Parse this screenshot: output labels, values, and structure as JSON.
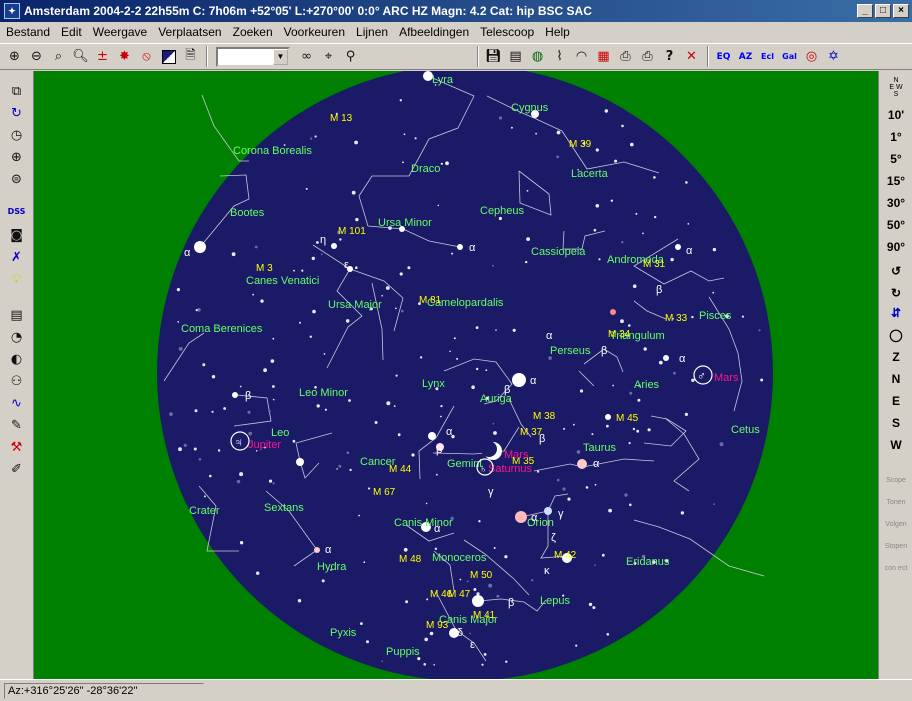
{
  "window": {
    "title": "Amsterdam 2004-2-2  22h55m C:  7h06m +52°05' L:+270°00' 0:0° ARC HZ  Magn: 4.2 Cat: hip BSC SAC"
  },
  "menu": [
    "Bestand",
    "Edit",
    "Weergave",
    "Verplaatsen",
    "Zoeken",
    "Voorkeuren",
    "Lijnen",
    "Afbeeldingen",
    "Telescoop",
    "Help"
  ],
  "right_toolbar": {
    "compass_labels": [
      "N",
      "E",
      "W",
      "S"
    ],
    "fov": [
      "10'",
      "1°",
      "5°",
      "15°",
      "30°",
      "50°",
      "90°"
    ],
    "directions": [
      "Z",
      "N",
      "E",
      "S",
      "W"
    ],
    "faded": [
      "Scope",
      "Tonen",
      "Volgen",
      "Stopen",
      "con ect"
    ]
  },
  "status": {
    "coords": "Az:+316°25'26\" -28°36'22\""
  },
  "colors": {
    "sky": "#1a1a66",
    "background": "#008000",
    "constellation": "#66ff66",
    "deep_sky": "#ffff00",
    "planet": "#ff1493",
    "line": "#c8c8dc"
  },
  "map": {
    "constellations": [
      {
        "name": "Lyra"
      },
      {
        "name": "Cygnus"
      },
      {
        "name": "Corona Borealis"
      },
      {
        "name": "Draco"
      },
      {
        "name": "Lacerta"
      },
      {
        "name": "Bootes"
      },
      {
        "name": "Ursa Minor"
      },
      {
        "name": "Cepheus"
      },
      {
        "name": "Cassiopeia"
      },
      {
        "name": "Andromeda"
      },
      {
        "name": "Canes Venatici"
      },
      {
        "name": "Ursa Major"
      },
      {
        "name": "Camelopardalis"
      },
      {
        "name": "Coma Berenices"
      },
      {
        "name": "Triangulum"
      },
      {
        "name": "Pisces"
      },
      {
        "name": "Perseus"
      },
      {
        "name": "Leo Minor"
      },
      {
        "name": "Lynx"
      },
      {
        "name": "Aries"
      },
      {
        "name": "Auriga"
      },
      {
        "name": "Leo"
      },
      {
        "name": "Taurus"
      },
      {
        "name": "Cetus"
      },
      {
        "name": "Cancer"
      },
      {
        "name": "Gemini"
      },
      {
        "name": "Crater"
      },
      {
        "name": "Sextans"
      },
      {
        "name": "Canis Minor"
      },
      {
        "name": "Orion"
      },
      {
        "name": "Monoceros"
      },
      {
        "name": "Eridanus"
      },
      {
        "name": "Hydra"
      },
      {
        "name": "Lepus"
      },
      {
        "name": "Canis Major"
      },
      {
        "name": "Pyxis"
      },
      {
        "name": "Puppis"
      }
    ],
    "deep_sky": [
      "M 13",
      "M 39",
      "M 101",
      "M 3",
      "M 81",
      "M 31",
      "M 33",
      "M 34",
      "M 38",
      "M 45",
      "M 37",
      "M 35",
      "M 44",
      "M 67",
      "M 42",
      "M 48",
      "M 50",
      "M 46",
      "M 47",
      "M 41",
      "M 93"
    ],
    "planets": [
      "Jupiter",
      "Mars",
      "Saturnus",
      "Mars"
    ],
    "greek": [
      "α",
      "β",
      "γ",
      "δ",
      "ε",
      "η",
      "κ",
      "ζ"
    ]
  }
}
